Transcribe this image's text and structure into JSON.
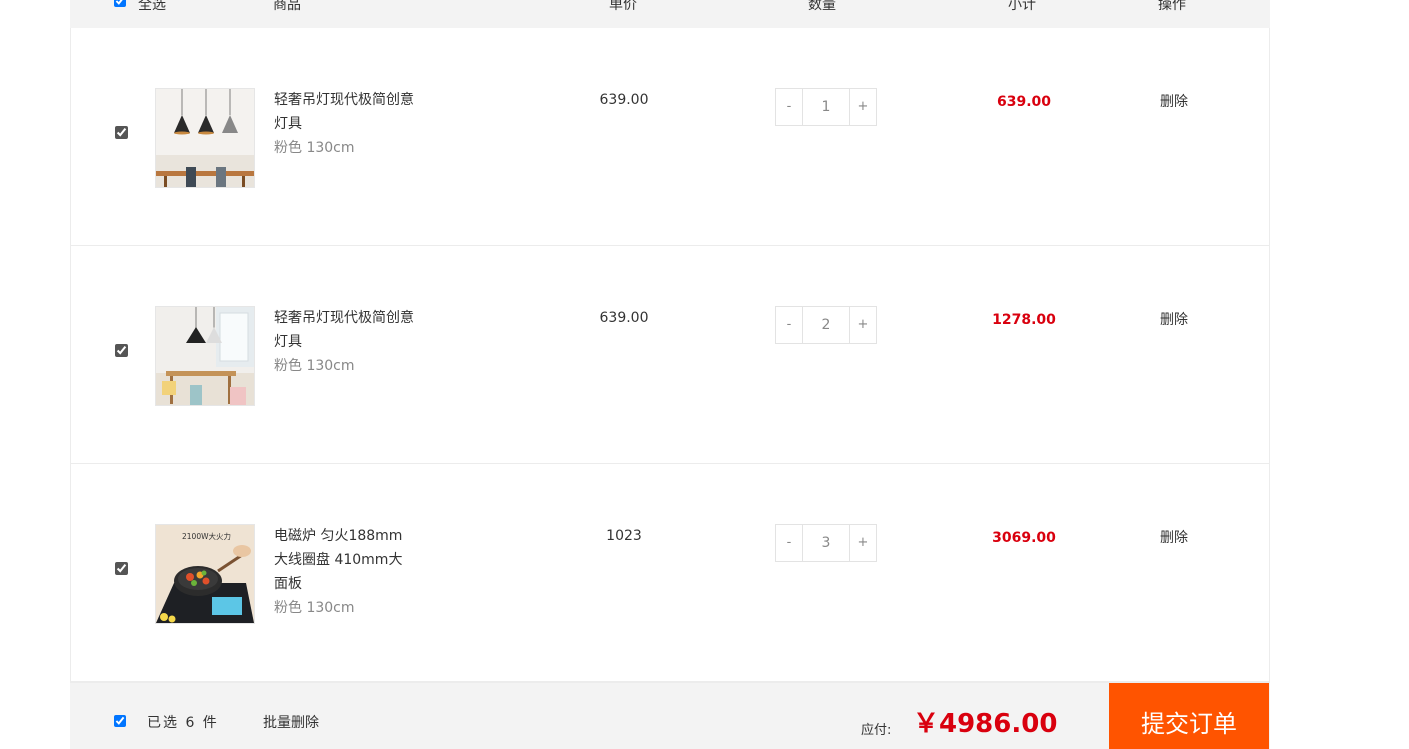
{
  "header": {
    "select_all": "全选",
    "product": "商品",
    "unit_price": "单价",
    "quantity": "数量",
    "subtotal": "小计",
    "action": "操作"
  },
  "items": [
    {
      "name": "轻奢吊灯现代极简创意灯具",
      "spec": "粉色 130cm",
      "price": "639.00",
      "qty": "1",
      "subtotal": "639.00",
      "delete": "删除",
      "minus": "-",
      "plus": "+"
    },
    {
      "name": "轻奢吊灯现代极简创意灯具",
      "spec": "粉色 130cm",
      "price": "639.00",
      "qty": "2",
      "subtotal": "1278.00",
      "delete": "删除",
      "minus": "-",
      "plus": "+"
    },
    {
      "name": "电磁炉 匀火188mm大线圈盘 410mm大面板",
      "spec": "粉色 130cm",
      "price": "1023",
      "qty": "3",
      "subtotal": "3069.00",
      "delete": "删除",
      "minus": "-",
      "plus": "+",
      "image_caption": "2100W大火力"
    }
  ],
  "footer": {
    "selected_count": "已选 6 件",
    "batch_delete": "批量删除",
    "total_label": "应付:",
    "total_value": "￥4986.00",
    "submit": "提交订单"
  },
  "colors": {
    "accent_red": "#d9000e",
    "submit_orange": "#ff5400",
    "header_bg": "#f3f3f3"
  }
}
